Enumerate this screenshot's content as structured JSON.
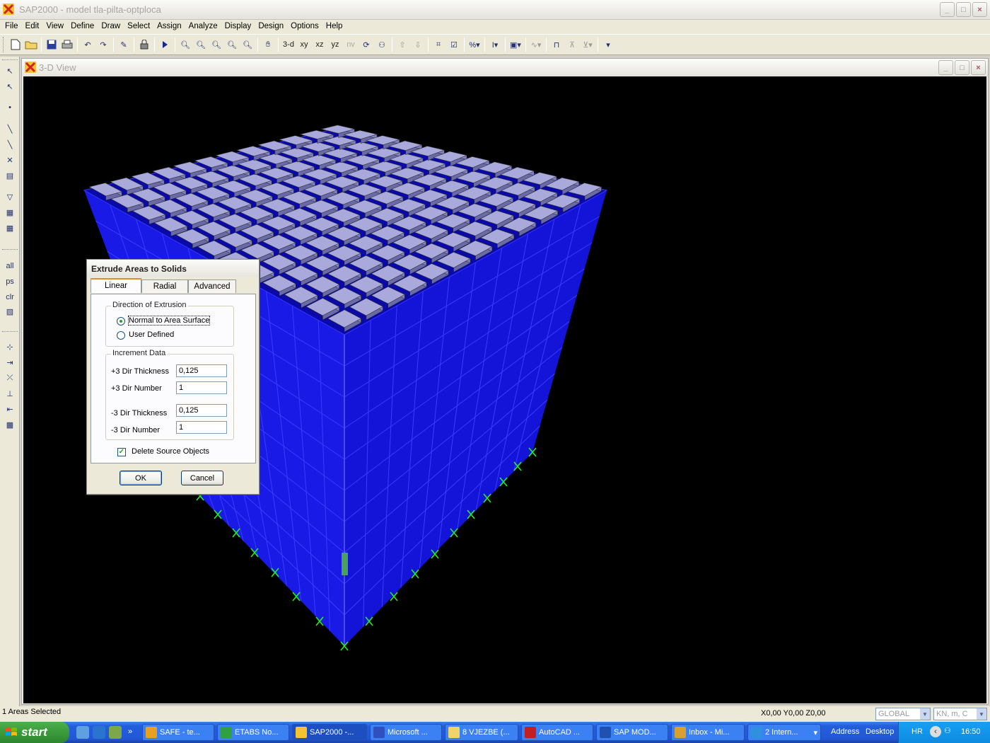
{
  "app": {
    "title": "SAP2000 - model tla-pilta-optploca",
    "window_buttons": [
      "_",
      "□",
      "×"
    ]
  },
  "menu": [
    "File",
    "Edit",
    "View",
    "Define",
    "Draw",
    "Select",
    "Assign",
    "Analyze",
    "Display",
    "Design",
    "Options",
    "Help"
  ],
  "toolbar": {
    "view_buttons": [
      "3-d",
      "xy",
      "xz",
      "yz",
      "nv"
    ]
  },
  "left_toolbar": {
    "select_labels": [
      "all",
      "ps",
      "clr"
    ]
  },
  "child_window": {
    "title": "3-D View"
  },
  "dialog": {
    "title": "Extrude Areas to Solids",
    "tabs": [
      "Linear",
      "Radial",
      "Advanced"
    ],
    "active_tab": "Linear",
    "direction_group": "Direction of Extrusion",
    "radio_normal": "Normal to Area Surface",
    "radio_user": "User Defined",
    "selected_direction": "Normal to Area Surface",
    "increment_group": "Increment Data",
    "plus3_thickness_label": "+3 Dir Thickness",
    "plus3_thickness": "0,125",
    "plus3_number_label": "+3 Dir Number",
    "plus3_number": "1",
    "minus3_thickness_label": "-3 Dir Thickness",
    "minus3_thickness": "0,125",
    "minus3_number_label": "-3 Dir Number",
    "minus3_number": "1",
    "delete_source_label": "Delete Source Objects",
    "delete_source_checked": true,
    "ok": "OK",
    "cancel": "Cancel"
  },
  "status": {
    "message": "1 Areas Selected",
    "coordinates": "X0,00  Y0,00  Z0,00",
    "coord_system": "GLOBAL",
    "units": "KN, m, C"
  },
  "taskbar": {
    "start": "start",
    "tasks": [
      "SAFE - te...",
      "ETABS No...",
      "SAP2000 -...",
      "Microsoft ...",
      "8 VJEZBE (...",
      "AutoCAD ...",
      "SAP  MOD...",
      "Inbox - Mi...",
      "2 Intern..."
    ],
    "address_label": "Address",
    "desktop_label": "Desktop",
    "language": "HR",
    "clock": "16:50"
  },
  "colors": {
    "model_blue": "#1a1ae6",
    "slab_tile": "#a9a9dc",
    "support_green": "#22ee22",
    "viewport_bg": "#000000"
  }
}
